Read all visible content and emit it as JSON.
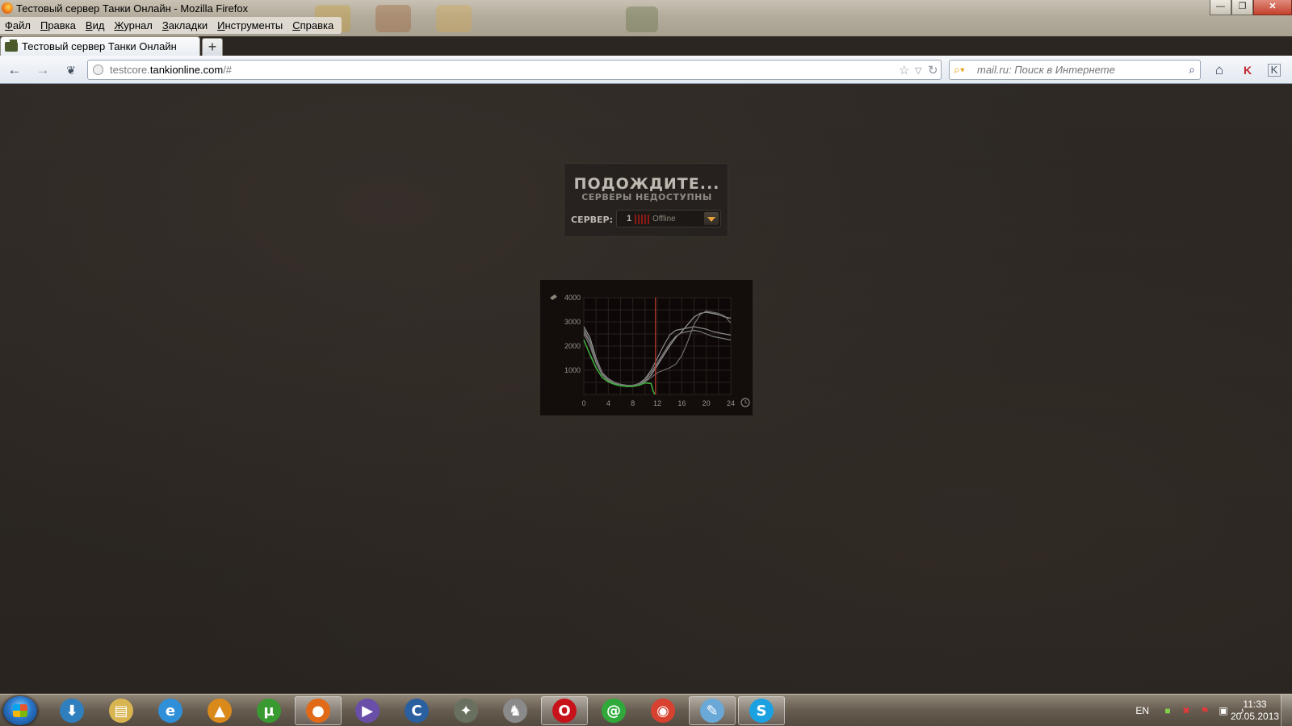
{
  "window": {
    "title": "Тестовый сервер Танки Онлайн - Mozilla Firefox",
    "minimize": "—",
    "maximize": "❐",
    "close": "✕"
  },
  "menu": [
    "Файл",
    "Правка",
    "Вид",
    "Журнал",
    "Закладки",
    "Инструменты",
    "Справка"
  ],
  "tabs": [
    {
      "title": "Тестовый сервер Танки Онлайн",
      "active": true
    }
  ],
  "new_tab_label": "+",
  "nav": {
    "url_host_prefix": "testcore.",
    "url_domain": "tankionline.com",
    "url_path": "/#",
    "search_placeholder": "mail.ru: Поиск в Интернете"
  },
  "wait_panel": {
    "title": "ПОДОЖДИТЕ...",
    "subtitle": "СЕРВЕРЫ НЕДОСТУПНЫ",
    "server_label": "СЕРВЕР:",
    "server_number": "1",
    "server_status": "Offline",
    "status_color": "#8b1a16"
  },
  "chart_data": {
    "type": "line",
    "x_ticks": [
      "0",
      "4",
      "8",
      "12",
      "16",
      "20",
      "24"
    ],
    "y_ticks": [
      "1000",
      "2000",
      "3000",
      "4000"
    ],
    "xlim": [
      0,
      24
    ],
    "ylim": [
      0,
      4000
    ],
    "grid": true,
    "current_time_marker": 11.7,
    "marker_color": "#c0392b",
    "series": [
      {
        "color": "#9a9a9a",
        "x": [
          0,
          1,
          2,
          3,
          4,
          5,
          6,
          7,
          8,
          9,
          10,
          11,
          12,
          13,
          14,
          15,
          16,
          17,
          18,
          19,
          20,
          21,
          22,
          23,
          24
        ],
        "values": [
          2800,
          2350,
          1500,
          900,
          650,
          500,
          420,
          380,
          380,
          420,
          550,
          800,
          1200,
          1600,
          2000,
          2350,
          2600,
          2900,
          3200,
          3350,
          3400,
          3350,
          3300,
          3200,
          3150
        ]
      },
      {
        "color": "#8a8a8a",
        "x": [
          0,
          1,
          2,
          3,
          4,
          5,
          6,
          7,
          8,
          9,
          10,
          11,
          12,
          13,
          14,
          15,
          16,
          17,
          18,
          19,
          20,
          21,
          22,
          23,
          24
        ],
        "values": [
          2600,
          2150,
          1400,
          850,
          600,
          480,
          400,
          370,
          380,
          450,
          650,
          1000,
          1500,
          2000,
          2450,
          2650,
          2700,
          2750,
          2800,
          2750,
          2700,
          2600,
          2550,
          2500,
          2450
        ]
      },
      {
        "color": "#7e7e7e",
        "x": [
          0,
          1,
          2,
          3,
          4,
          5,
          6,
          7,
          8,
          9,
          10,
          11,
          12,
          13,
          14,
          15,
          16,
          17,
          18,
          19,
          20,
          21,
          22,
          23,
          24
        ],
        "values": [
          2500,
          2000,
          1300,
          800,
          560,
          450,
          380,
          350,
          360,
          430,
          620,
          900,
          1300,
          1700,
          2100,
          2400,
          2550,
          2600,
          2650,
          2600,
          2500,
          2400,
          2350,
          2300,
          2250
        ]
      },
      {
        "color": "#6e6e6e",
        "x": [
          0,
          1,
          2,
          3,
          4,
          5,
          6,
          7,
          8,
          9,
          10,
          11,
          12,
          13,
          14,
          15,
          16,
          17,
          18,
          19,
          20,
          21,
          22,
          23,
          24
        ],
        "values": [
          2700,
          2200,
          1450,
          880,
          620,
          490,
          410,
          380,
          380,
          420,
          520,
          700,
          900,
          1000,
          1100,
          1250,
          1600,
          2200,
          2900,
          3300,
          3450,
          3400,
          3350,
          3250,
          2950
        ]
      },
      {
        "color": "#3fae3f",
        "x": [
          0,
          1,
          2,
          3,
          4,
          5,
          6,
          7,
          8,
          9,
          10,
          11,
          11.3,
          11.6
        ],
        "values": [
          2250,
          1650,
          1100,
          700,
          520,
          420,
          360,
          330,
          330,
          380,
          480,
          450,
          150,
          0
        ]
      }
    ]
  },
  "taskbar": {
    "apps": [
      {
        "name": "download",
        "glyph": "⬇",
        "bg": "#2f7fbf"
      },
      {
        "name": "explorer",
        "glyph": "▤",
        "bg": "#d9b552"
      },
      {
        "name": "internet-explorer",
        "glyph": "e",
        "bg": "#2f8fd8"
      },
      {
        "name": "aimp",
        "glyph": "▲",
        "bg": "#d98a1a"
      },
      {
        "name": "utorrent",
        "glyph": "µ",
        "bg": "#3a9a32"
      },
      {
        "name": "firefox",
        "glyph": "●",
        "bg": "#e06a18",
        "active": true
      },
      {
        "name": "visual-studio",
        "glyph": "▶",
        "bg": "#6a4fa8"
      },
      {
        "name": "ccleaner",
        "glyph": "C",
        "bg": "#2a5fa0"
      },
      {
        "name": "game",
        "glyph": "✦",
        "bg": "#6a7060"
      },
      {
        "name": "counter-strike",
        "glyph": "♞",
        "bg": "#8a8a8a"
      },
      {
        "name": "opera",
        "glyph": "O",
        "bg": "#c8121a",
        "active": true
      },
      {
        "name": "mail-agent",
        "glyph": "@",
        "bg": "#2faa3a"
      },
      {
        "name": "chrome",
        "glyph": "◉",
        "bg": "#d8412f"
      },
      {
        "name": "notepad",
        "glyph": "✎",
        "bg": "#6aa8d8",
        "active": true
      },
      {
        "name": "skype",
        "glyph": "S",
        "bg": "#1ba1e2",
        "active": true
      }
    ],
    "lang": "EN",
    "time": "11:33",
    "date": "20.05.2013"
  }
}
